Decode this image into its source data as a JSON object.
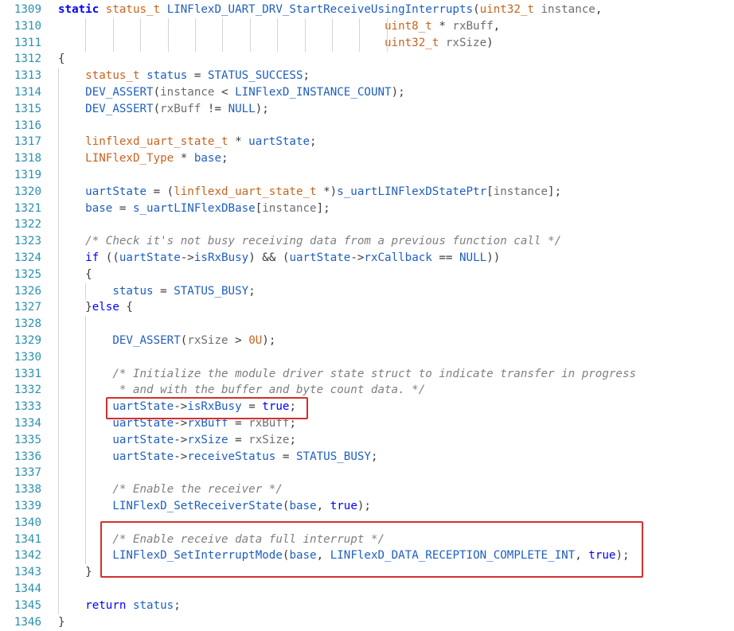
{
  "editor": {
    "colors": {
      "keyword": "#0000ff",
      "type": "#c8641e",
      "function": "#1f5fbf",
      "variable": "#1f5fbf",
      "macro": "#1f5fbf",
      "parameter": "#6f6f6f",
      "comment": "#7f7f7f",
      "number": "#c8641e",
      "plain": "#3c3c3c",
      "line_number": "#2b91af",
      "highlight_box": "#d32f2f"
    },
    "lines": [
      {
        "n": "1309",
        "tokens": [
          [
            "static",
            "kw"
          ],
          [
            " ",
            ""
          ],
          [
            "status_t",
            "type"
          ],
          [
            " ",
            ""
          ],
          [
            "LINFlexD_UART_DRV_StartReceiveUsingInterrupts",
            "fn"
          ],
          [
            "(",
            ""
          ],
          [
            "uint32_t",
            "type"
          ],
          [
            " ",
            ""
          ],
          [
            "instance",
            "param"
          ],
          [
            ",",
            ""
          ]
        ]
      },
      {
        "n": "1310",
        "tokens": [
          [
            "                                                ",
            ""
          ],
          [
            "uint8_t",
            "type"
          ],
          [
            " * ",
            ""
          ],
          [
            "rxBuff",
            "param"
          ],
          [
            ",",
            ""
          ]
        ]
      },
      {
        "n": "1311",
        "tokens": [
          [
            "                                                ",
            ""
          ],
          [
            "uint32_t",
            "type"
          ],
          [
            " ",
            ""
          ],
          [
            "rxSize",
            "param"
          ],
          [
            ")",
            ""
          ]
        ]
      },
      {
        "n": "1312",
        "tokens": [
          [
            "{",
            ""
          ]
        ]
      },
      {
        "n": "1313",
        "tokens": [
          [
            "    ",
            ""
          ],
          [
            "status_t",
            "type"
          ],
          [
            " ",
            ""
          ],
          [
            "status",
            "var"
          ],
          [
            " = ",
            ""
          ],
          [
            "STATUS_SUCCESS",
            "macro"
          ],
          [
            ";",
            ""
          ]
        ]
      },
      {
        "n": "1314",
        "tokens": [
          [
            "    ",
            ""
          ],
          [
            "DEV_ASSERT",
            "macro"
          ],
          [
            "(",
            ""
          ],
          [
            "instance",
            "param"
          ],
          [
            " < ",
            ""
          ],
          [
            "LINFlexD_INSTANCE_COUNT",
            "macro"
          ],
          [
            ");",
            ""
          ]
        ]
      },
      {
        "n": "1315",
        "tokens": [
          [
            "    ",
            ""
          ],
          [
            "DEV_ASSERT",
            "macro"
          ],
          [
            "(",
            ""
          ],
          [
            "rxBuff",
            "param"
          ],
          [
            " != ",
            ""
          ],
          [
            "NULL",
            "macro"
          ],
          [
            ");",
            ""
          ]
        ]
      },
      {
        "n": "1316",
        "tokens": []
      },
      {
        "n": "1317",
        "tokens": [
          [
            "    ",
            ""
          ],
          [
            "linflexd_uart_state_t",
            "type"
          ],
          [
            " * ",
            ""
          ],
          [
            "uartState",
            "var"
          ],
          [
            ";",
            ""
          ]
        ]
      },
      {
        "n": "1318",
        "tokens": [
          [
            "    ",
            ""
          ],
          [
            "LINFlexD_Type",
            "type"
          ],
          [
            " * ",
            ""
          ],
          [
            "base",
            "var"
          ],
          [
            ";",
            ""
          ]
        ]
      },
      {
        "n": "1319",
        "tokens": []
      },
      {
        "n": "1320",
        "tokens": [
          [
            "    ",
            ""
          ],
          [
            "uartState",
            "var"
          ],
          [
            " = (",
            ""
          ],
          [
            "linflexd_uart_state_t",
            "type"
          ],
          [
            " *)",
            ""
          ],
          [
            "s_uartLINFlexDStatePtr",
            "var"
          ],
          [
            "[",
            ""
          ],
          [
            "instance",
            "param"
          ],
          [
            "];",
            ""
          ]
        ]
      },
      {
        "n": "1321",
        "tokens": [
          [
            "    ",
            ""
          ],
          [
            "base",
            "var"
          ],
          [
            " = ",
            ""
          ],
          [
            "s_uartLINFlexDBase",
            "var"
          ],
          [
            "[",
            ""
          ],
          [
            "instance",
            "param"
          ],
          [
            "];",
            ""
          ]
        ]
      },
      {
        "n": "1322",
        "tokens": []
      },
      {
        "n": "1323",
        "tokens": [
          [
            "    ",
            ""
          ],
          [
            "/* Check it's not busy receiving data from a previous function call */",
            "comment"
          ]
        ]
      },
      {
        "n": "1324",
        "tokens": [
          [
            "    ",
            ""
          ],
          [
            "if",
            "kw"
          ],
          [
            " ((",
            ""
          ],
          [
            "uartState",
            "var"
          ],
          [
            "->",
            ""
          ],
          [
            "isRxBusy",
            "var"
          ],
          [
            ") && (",
            ""
          ],
          [
            "uartState",
            "var"
          ],
          [
            "->",
            ""
          ],
          [
            "rxCallback",
            "var"
          ],
          [
            " == ",
            ""
          ],
          [
            "NULL",
            "macro"
          ],
          [
            "))",
            ""
          ]
        ]
      },
      {
        "n": "1325",
        "tokens": [
          [
            "    {",
            ""
          ]
        ]
      },
      {
        "n": "1326",
        "tokens": [
          [
            "        ",
            ""
          ],
          [
            "status",
            "var"
          ],
          [
            " = ",
            ""
          ],
          [
            "STATUS_BUSY",
            "macro"
          ],
          [
            ";",
            ""
          ]
        ]
      },
      {
        "n": "1327",
        "tokens": [
          [
            "    }",
            ""
          ],
          [
            "else",
            "kw"
          ],
          [
            " {",
            ""
          ]
        ]
      },
      {
        "n": "1328",
        "tokens": []
      },
      {
        "n": "1329",
        "tokens": [
          [
            "        ",
            ""
          ],
          [
            "DEV_ASSERT",
            "macro"
          ],
          [
            "(",
            ""
          ],
          [
            "rxSize",
            "param"
          ],
          [
            " > ",
            ""
          ],
          [
            "0U",
            "num"
          ],
          [
            ");",
            ""
          ]
        ]
      },
      {
        "n": "1330",
        "tokens": []
      },
      {
        "n": "1331",
        "tokens": [
          [
            "        ",
            ""
          ],
          [
            "/* Initialize the module driver state struct to indicate transfer in progress",
            "comment"
          ]
        ]
      },
      {
        "n": "1332",
        "tokens": [
          [
            "        ",
            ""
          ],
          [
            " * and with the buffer and byte count data. */",
            "comment"
          ]
        ]
      },
      {
        "n": "1333",
        "tokens": [
          [
            "        ",
            ""
          ],
          [
            "uartState",
            "var"
          ],
          [
            "->",
            ""
          ],
          [
            "isRxBusy",
            "var"
          ],
          [
            " = ",
            ""
          ],
          [
            "true",
            "kw"
          ],
          [
            ";",
            ""
          ]
        ]
      },
      {
        "n": "1334",
        "tokens": [
          [
            "        ",
            ""
          ],
          [
            "uartState",
            "var"
          ],
          [
            "->",
            ""
          ],
          [
            "rxBuff",
            "var"
          ],
          [
            " = ",
            ""
          ],
          [
            "rxBuff",
            "param"
          ],
          [
            ";",
            ""
          ]
        ]
      },
      {
        "n": "1335",
        "tokens": [
          [
            "        ",
            ""
          ],
          [
            "uartState",
            "var"
          ],
          [
            "->",
            ""
          ],
          [
            "rxSize",
            "var"
          ],
          [
            " = ",
            ""
          ],
          [
            "rxSize",
            "param"
          ],
          [
            ";",
            ""
          ]
        ]
      },
      {
        "n": "1336",
        "tokens": [
          [
            "        ",
            ""
          ],
          [
            "uartState",
            "var"
          ],
          [
            "->",
            ""
          ],
          [
            "receiveStatus",
            "var"
          ],
          [
            " = ",
            ""
          ],
          [
            "STATUS_BUSY",
            "macro"
          ],
          [
            ";",
            ""
          ]
        ]
      },
      {
        "n": "1337",
        "tokens": []
      },
      {
        "n": "1338",
        "tokens": [
          [
            "        ",
            ""
          ],
          [
            "/* Enable the receiver */",
            "comment"
          ]
        ]
      },
      {
        "n": "1339",
        "tokens": [
          [
            "        ",
            ""
          ],
          [
            "LINFlexD_SetReceiverState",
            "fn"
          ],
          [
            "(",
            ""
          ],
          [
            "base",
            "var"
          ],
          [
            ", ",
            ""
          ],
          [
            "true",
            "kw"
          ],
          [
            ");",
            ""
          ]
        ]
      },
      {
        "n": "1340",
        "tokens": []
      },
      {
        "n": "1341",
        "tokens": [
          [
            "        ",
            ""
          ],
          [
            "/* Enable receive data full interrupt */",
            "comment"
          ]
        ]
      },
      {
        "n": "1342",
        "tokens": [
          [
            "        ",
            ""
          ],
          [
            "LINFlexD_SetInterruptMode",
            "fn"
          ],
          [
            "(",
            ""
          ],
          [
            "base",
            "var"
          ],
          [
            ", ",
            ""
          ],
          [
            "LINFlexD_DATA_RECEPTION_COMPLETE_INT",
            "macro"
          ],
          [
            ", ",
            ""
          ],
          [
            "true",
            "kw"
          ],
          [
            ");",
            ""
          ]
        ]
      },
      {
        "n": "1343",
        "tokens": [
          [
            "    }",
            ""
          ]
        ]
      },
      {
        "n": "1344",
        "tokens": []
      },
      {
        "n": "1345",
        "tokens": [
          [
            "    ",
            ""
          ],
          [
            "return",
            "kw"
          ],
          [
            " ",
            ""
          ],
          [
            "status",
            "var"
          ],
          [
            ";",
            ""
          ]
        ]
      },
      {
        "n": "1346",
        "tokens": [
          [
            "}",
            ""
          ]
        ]
      }
    ]
  }
}
